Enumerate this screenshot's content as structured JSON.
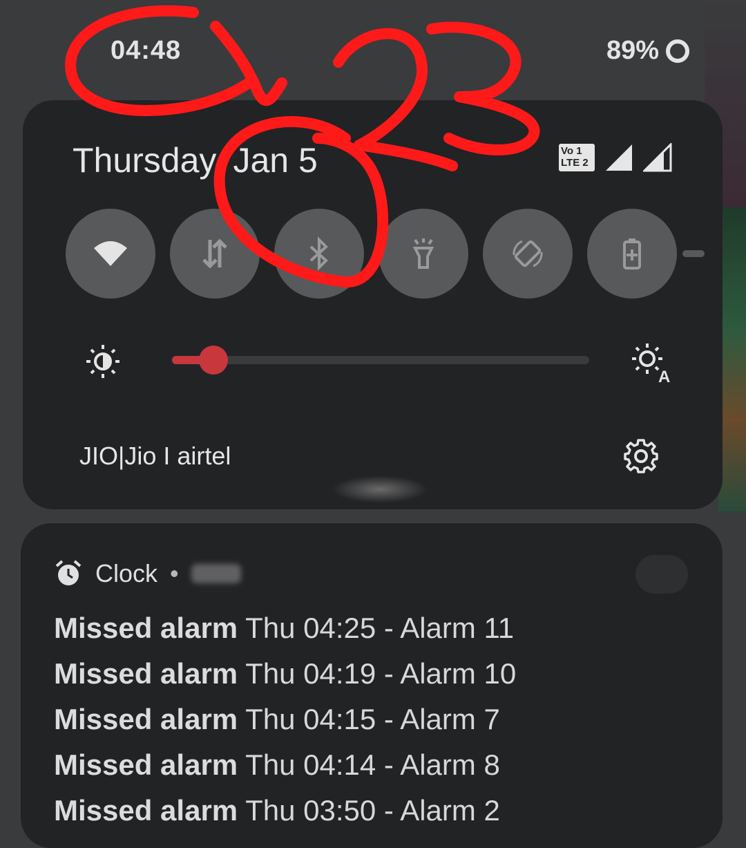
{
  "status_bar": {
    "time": "04:48",
    "battery": "89%"
  },
  "quick_settings": {
    "date": "Thursday, Jan 5",
    "volte_badge": "Vo 1\nLTE 2",
    "tiles": [
      {
        "name": "wifi",
        "icon": "wifi-icon"
      },
      {
        "name": "mobile-data",
        "icon": "data-arrows-icon"
      },
      {
        "name": "bluetooth",
        "icon": "bluetooth-icon"
      },
      {
        "name": "flashlight",
        "icon": "flashlight-icon"
      },
      {
        "name": "auto-rotate",
        "icon": "rotate-icon"
      },
      {
        "name": "battery-saver",
        "icon": "battery-plus-icon"
      }
    ],
    "brightness_level": 0.1,
    "carrier": "JIO|Jio I airtel"
  },
  "notification": {
    "app": "Clock",
    "separator": "•",
    "alarms": [
      {
        "title": "Missed alarm",
        "detail": "Thu 04:25 - Alarm 11"
      },
      {
        "title": "Missed alarm",
        "detail": "Thu 04:19 - Alarm 10"
      },
      {
        "title": "Missed alarm",
        "detail": "Thu 04:15 - Alarm 7"
      },
      {
        "title": "Missed alarm",
        "detail": "Thu 04:14 - Alarm 8"
      },
      {
        "title": "Missed alarm",
        "detail": "Thu 03:50 - Alarm 2"
      }
    ]
  },
  "colors": {
    "accent": "#c8373c",
    "panel": "#222325",
    "tile": "#58595b",
    "annotation": "#ff0000"
  }
}
